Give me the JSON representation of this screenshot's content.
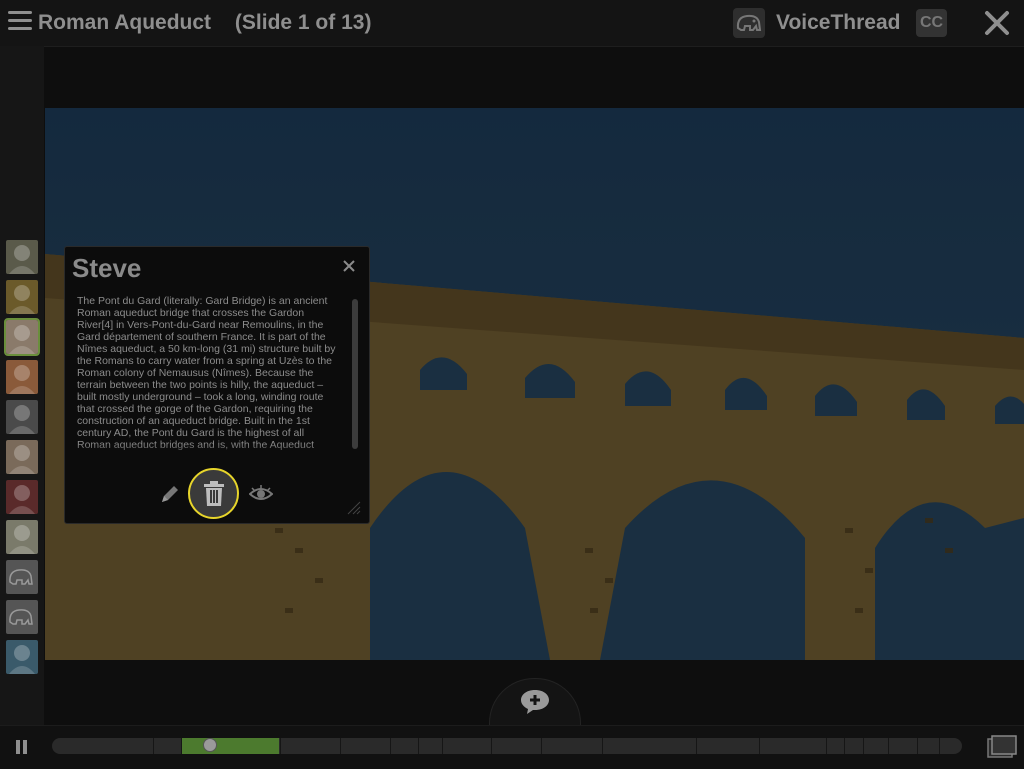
{
  "header": {
    "title": "Roman Aqueduct",
    "slide_info": "(Slide 1 of 13)",
    "app_name": "VoiceThread",
    "cc_label": "CC"
  },
  "comment": {
    "author": "Steve",
    "text": "The Pont du Gard (literally: Gard Bridge) is an ancient Roman aqueduct bridge that crosses the Gardon River[4] in Vers-Pont-du-Gard near Remoulins, in the Gard département of southern France. It is part of the Nîmes aqueduct, a 50 km-long (31 mi) structure built by the Romans to carry water from a spring at Uzès to the Roman colony of Nemausus (Nîmes). Because the terrain between the two points is hilly, the aqueduct – built mostly underground – took a long, winding route that crossed the gorge of the Gardon, requiring the construction of an aqueduct bridge. Built in the 1st century AD, the Pont du Gard is the highest of all Roman aqueduct bridges and is, with the Aqueduct"
  },
  "commenters": [
    {
      "name": "avatar-1",
      "icon": "photo",
      "color": "#5a5a4a"
    },
    {
      "name": "avatar-2",
      "icon": "photo",
      "color": "#6b5a2a"
    },
    {
      "name": "avatar-steve",
      "icon": "photo",
      "color": "#8a7a6a",
      "active": true
    },
    {
      "name": "avatar-4",
      "icon": "photo",
      "color": "#8a5a3a"
    },
    {
      "name": "avatar-5",
      "icon": "photo",
      "color": "#4a4a4a"
    },
    {
      "name": "avatar-6",
      "icon": "photo",
      "color": "#7a6a5a"
    },
    {
      "name": "avatar-7",
      "icon": "photo",
      "color": "#5a2a2a"
    },
    {
      "name": "avatar-8",
      "icon": "photo",
      "color": "#7a7a6a"
    },
    {
      "name": "avatar-9",
      "icon": "elephant",
      "color": "#555"
    },
    {
      "name": "avatar-10",
      "icon": "elephant",
      "color": "#555"
    },
    {
      "name": "avatar-11",
      "icon": "photo",
      "color": "#3a5a6a"
    }
  ],
  "playback": {
    "progress_start": 0.142,
    "progress_end": 0.25,
    "scrubber_position": 0.174
  },
  "colors": {
    "accent_highlight": "#e7d52b",
    "timeline_fill": "#4c7a2e"
  }
}
